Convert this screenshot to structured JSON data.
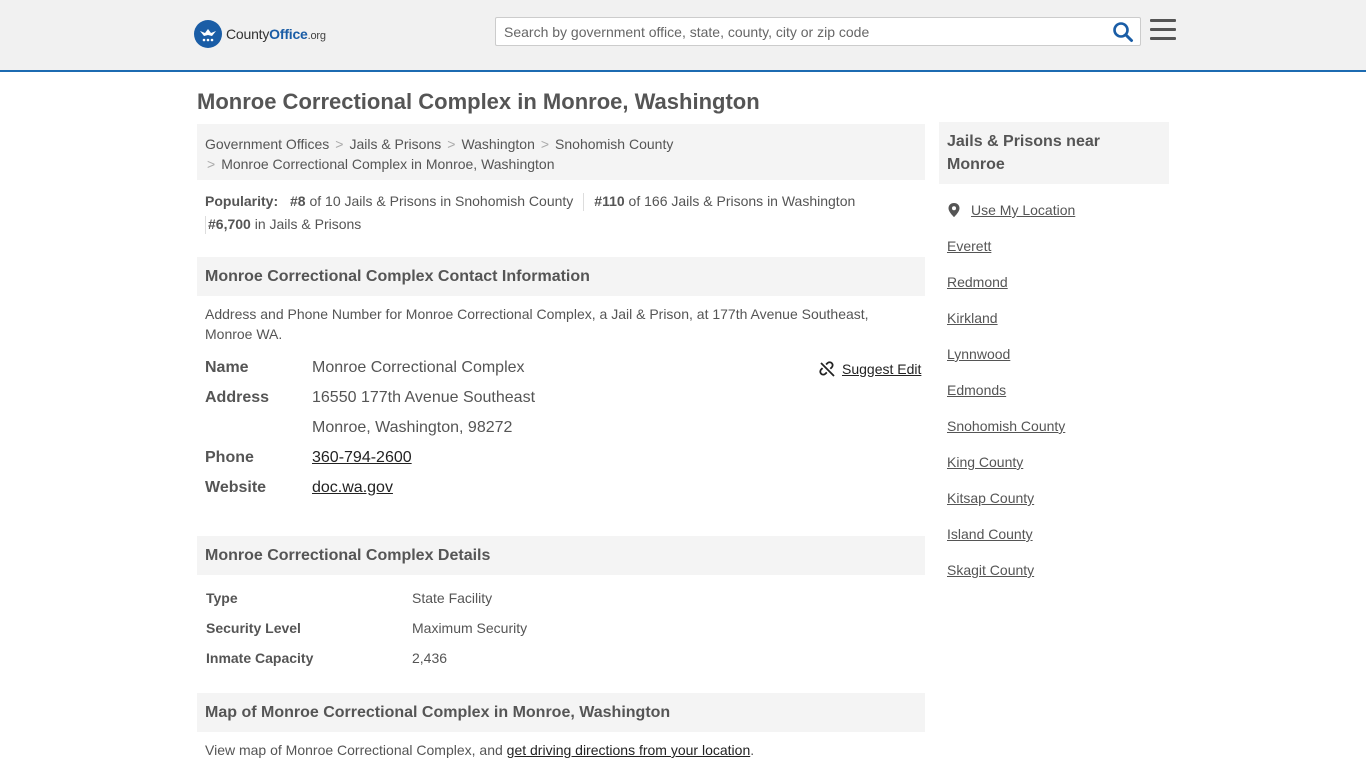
{
  "header": {
    "logo_main": "County",
    "logo_brand": "Office",
    "logo_suffix": ".org",
    "search_placeholder": "Search by government office, state, county, city or zip code"
  },
  "page_title": "Monroe Correctional Complex in Monroe, Washington",
  "breadcrumb": {
    "items": [
      "Government Offices",
      "Jails & Prisons",
      "Washington",
      "Snohomish County"
    ],
    "current": "Monroe Correctional Complex in Monroe, Washington"
  },
  "popularity": {
    "label": "Popularity:",
    "rank1": "#8",
    "text1": " of 10 Jails & Prisons in Snohomish County",
    "rank2": "#110",
    "text2": " of 166 Jails & Prisons in Washington",
    "rank3": "#6,700",
    "text3": " in Jails & Prisons"
  },
  "contact": {
    "heading": "Monroe Correctional Complex Contact Information",
    "description": "Address and Phone Number for Monroe Correctional Complex, a Jail & Prison, at 177th Avenue Southeast, Monroe WA.",
    "suggest_edit": "Suggest Edit",
    "name_label": "Name",
    "name": "Monroe Correctional Complex",
    "address_label": "Address",
    "address_line1": "16550 177th Avenue Southeast",
    "address_line2": "Monroe, Washington, 98272",
    "phone_label": "Phone",
    "phone": "360-794-2600",
    "website_label": "Website",
    "website": "doc.wa.gov"
  },
  "details": {
    "heading": "Monroe Correctional Complex Details",
    "rows": [
      {
        "label": "Type",
        "value": "State Facility"
      },
      {
        "label": "Security Level",
        "value": "Maximum Security"
      },
      {
        "label": "Inmate Capacity",
        "value": "2,436"
      }
    ]
  },
  "map": {
    "heading": "Map of Monroe Correctional Complex in Monroe, Washington",
    "text": "View map of Monroe Correctional Complex, and ",
    "link": "get driving directions from your location",
    "suffix": "."
  },
  "sidebar": {
    "heading": "Jails & Prisons near Monroe",
    "use_location": "Use My Location",
    "links": [
      "Everett",
      "Redmond",
      "Kirkland",
      "Lynnwood",
      "Edmonds",
      "Snohomish County",
      "King County",
      "Kitsap County",
      "Island County",
      "Skagit County"
    ]
  },
  "colors": {
    "brand_blue": "#1a5da6",
    "header_bg": "#f1f1f1",
    "panel_bg": "#f4f4f4"
  }
}
